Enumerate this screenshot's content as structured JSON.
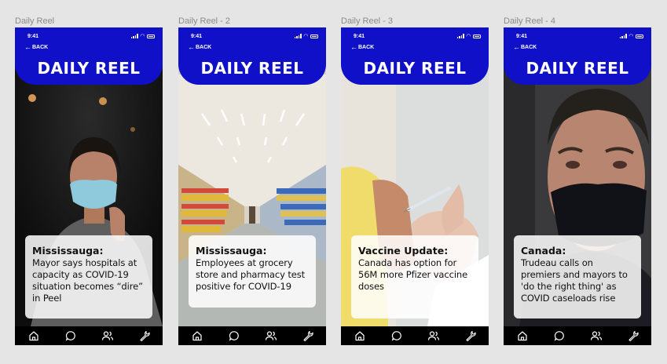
{
  "screens": [
    {
      "frame_label": "Daily Reel",
      "time": "9:41",
      "back_label": "BACK",
      "brand": "DAILY REEL",
      "headline_kicker": "Mississauga:",
      "headline_body": "Mayor says hospitals at capacity as COVID-19 situation becomes “dire” in Peel",
      "photo": "woman-wearing-mask"
    },
    {
      "frame_label": "Daily Reel - 2",
      "time": "9:41",
      "back_label": "BACK",
      "brand": "DAILY REEL",
      "headline_kicker": "Mississauga:",
      "headline_body": "Employees at grocery store and pharmacy test positive for COVID-19",
      "photo": "grocery-store-aisle"
    },
    {
      "frame_label": "Daily Reel - 3",
      "time": "9:41",
      "back_label": "BACK",
      "brand": "DAILY REEL",
      "headline_kicker": "Vaccine Update:",
      "headline_body": "Canada has option for 56M more Pfizer vaccine doses",
      "photo": "vaccine-injection"
    },
    {
      "frame_label": "Daily Reel - 4",
      "time": "9:41",
      "back_label": "BACK",
      "brand": "DAILY REEL",
      "headline_kicker": "Canada:",
      "headline_body": "Trudeau calls on premiers and mayors to 'do the right thing' as COVID caseloads rise",
      "photo": "man-wearing-mask"
    }
  ],
  "tab_icons": [
    "home-icon",
    "chat-icon",
    "people-icon",
    "wrench-icon"
  ],
  "colors": {
    "canvas": "#e5e5e5",
    "header": "#1010c8",
    "tabbar": "#000000",
    "card": "#ffffff"
  }
}
